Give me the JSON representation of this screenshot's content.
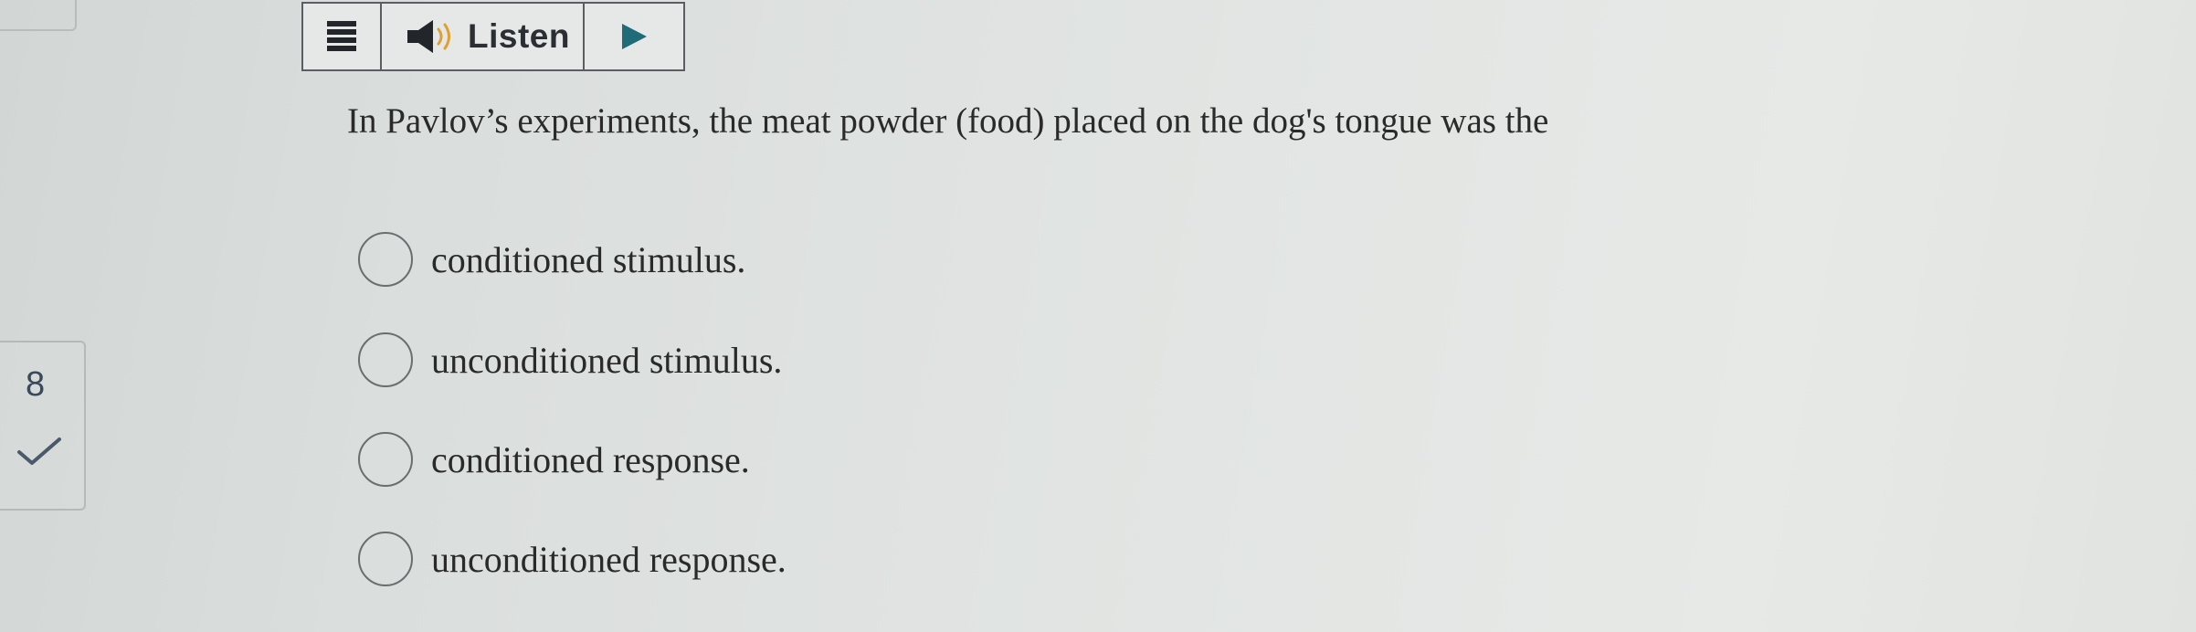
{
  "toolbar": {
    "listen_label": "Listen",
    "icons": {
      "menu": "hamburger-menu-icon",
      "speaker": "speaker-icon",
      "play": "play-icon"
    }
  },
  "question_nav": {
    "number": "8",
    "status_icon": "checkmark-icon"
  },
  "question": {
    "text": "In Pavlov’s experiments, the meat powder (food) placed on the dog's tongue was the",
    "options": [
      {
        "label": "conditioned stimulus."
      },
      {
        "label": "unconditioned stimulus."
      },
      {
        "label": "conditioned response."
      },
      {
        "label": "unconditioned response."
      }
    ]
  },
  "colors": {
    "background": "#e2e5e3",
    "text": "#2a2a2a",
    "toolbar_border": "#5a5e62",
    "check": "#4a5a6a"
  }
}
